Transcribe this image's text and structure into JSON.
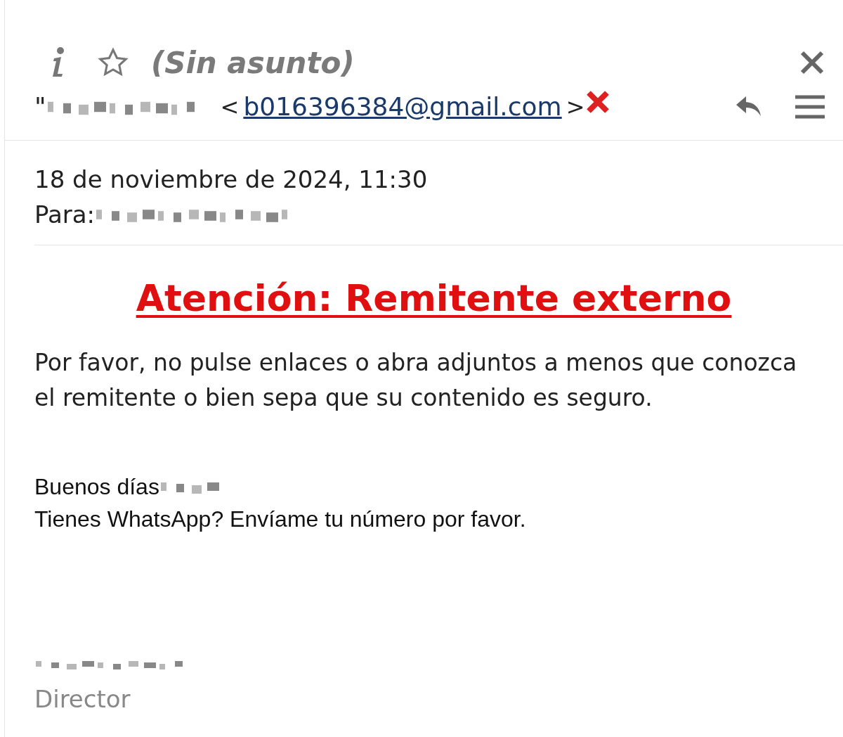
{
  "header": {
    "subject": "(Sin asunto)",
    "starred": false
  },
  "sender": {
    "quote": "\"",
    "open_bracket": "<",
    "email": "b016396384@gmail.com",
    "close_bracket": ">"
  },
  "meta": {
    "date": "18 de noviembre de 2024, 11:30",
    "to_label": "Para:"
  },
  "warning": {
    "title": "Atención: Remitente externo",
    "text": "Por favor, no pulse enlaces o abra adjuntos a menos que conozca el remitente o bien sepa que su contenido es seguro."
  },
  "body": {
    "greeting": "Buenos días",
    "line": "Tienes WhatsApp? Envíame tu número por favor."
  },
  "signature": {
    "role": "Director"
  }
}
